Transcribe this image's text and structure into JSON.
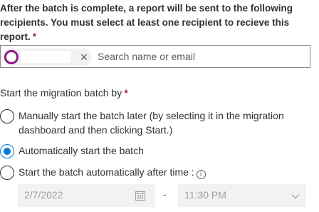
{
  "report": {
    "description": "After the batch is complete, a report will be sent to the following recipients. You must select at least one recipient to recieve this report.",
    "required_marker": "*"
  },
  "recipients": {
    "chip_remove_glyph": "✕",
    "search_placeholder": "Search name or email",
    "avatar_color": "#8a1d8a"
  },
  "start_batch": {
    "label": "Start the migration batch by",
    "required_marker": "*",
    "options": [
      {
        "label": "Manually start the batch later (by selecting it in the migration dashboard and then clicking Start.)",
        "checked": false
      },
      {
        "label": "Automatically start the batch",
        "checked": true
      },
      {
        "label": "Start the batch automatically after time :",
        "checked": false
      }
    ],
    "info_glyph": "i"
  },
  "schedule": {
    "date_value": "2/7/2022",
    "separator": "-",
    "time_value": "11:30 PM"
  },
  "colors": {
    "accent": "#0078d4",
    "required": "#a4262c",
    "disabled_text": "#a19f9d",
    "disabled_bg": "#f3f2f1"
  }
}
